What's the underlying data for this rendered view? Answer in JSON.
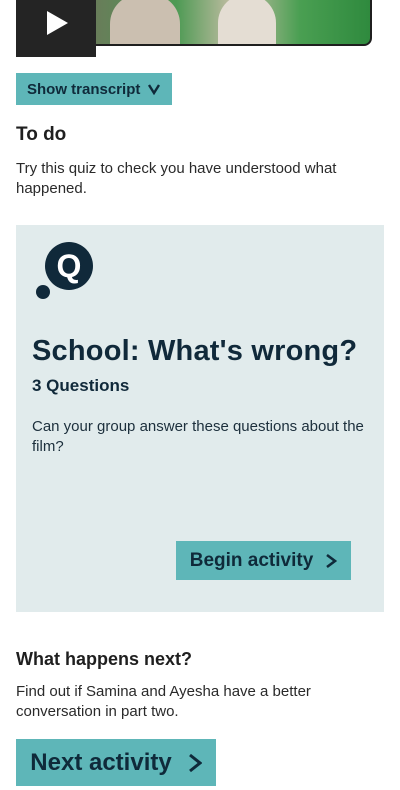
{
  "video": {
    "play_icon": "play-icon"
  },
  "transcript": {
    "label": "Show transcript",
    "icon": "chevron-down-icon"
  },
  "todo": {
    "heading": "To do",
    "text": "Try this quiz to check you have understood what happened."
  },
  "quiz": {
    "logo_icon": "quiz-q-icon",
    "title": "School: What's wrong?",
    "count": "3 Questions",
    "description": "Can your group answer these questions about the film?",
    "begin_label": "Begin activity",
    "begin_icon": "chevron-right-icon"
  },
  "next": {
    "heading": "What happens next?",
    "text": "Find out if Samina and Ayesha have a better conversation in part two.",
    "button_label": "Next activity",
    "button_icon": "chevron-right-icon"
  },
  "colors": {
    "accent": "#5eb6b8",
    "card_bg": "#e1ebec",
    "dark_text": "#10293a"
  }
}
